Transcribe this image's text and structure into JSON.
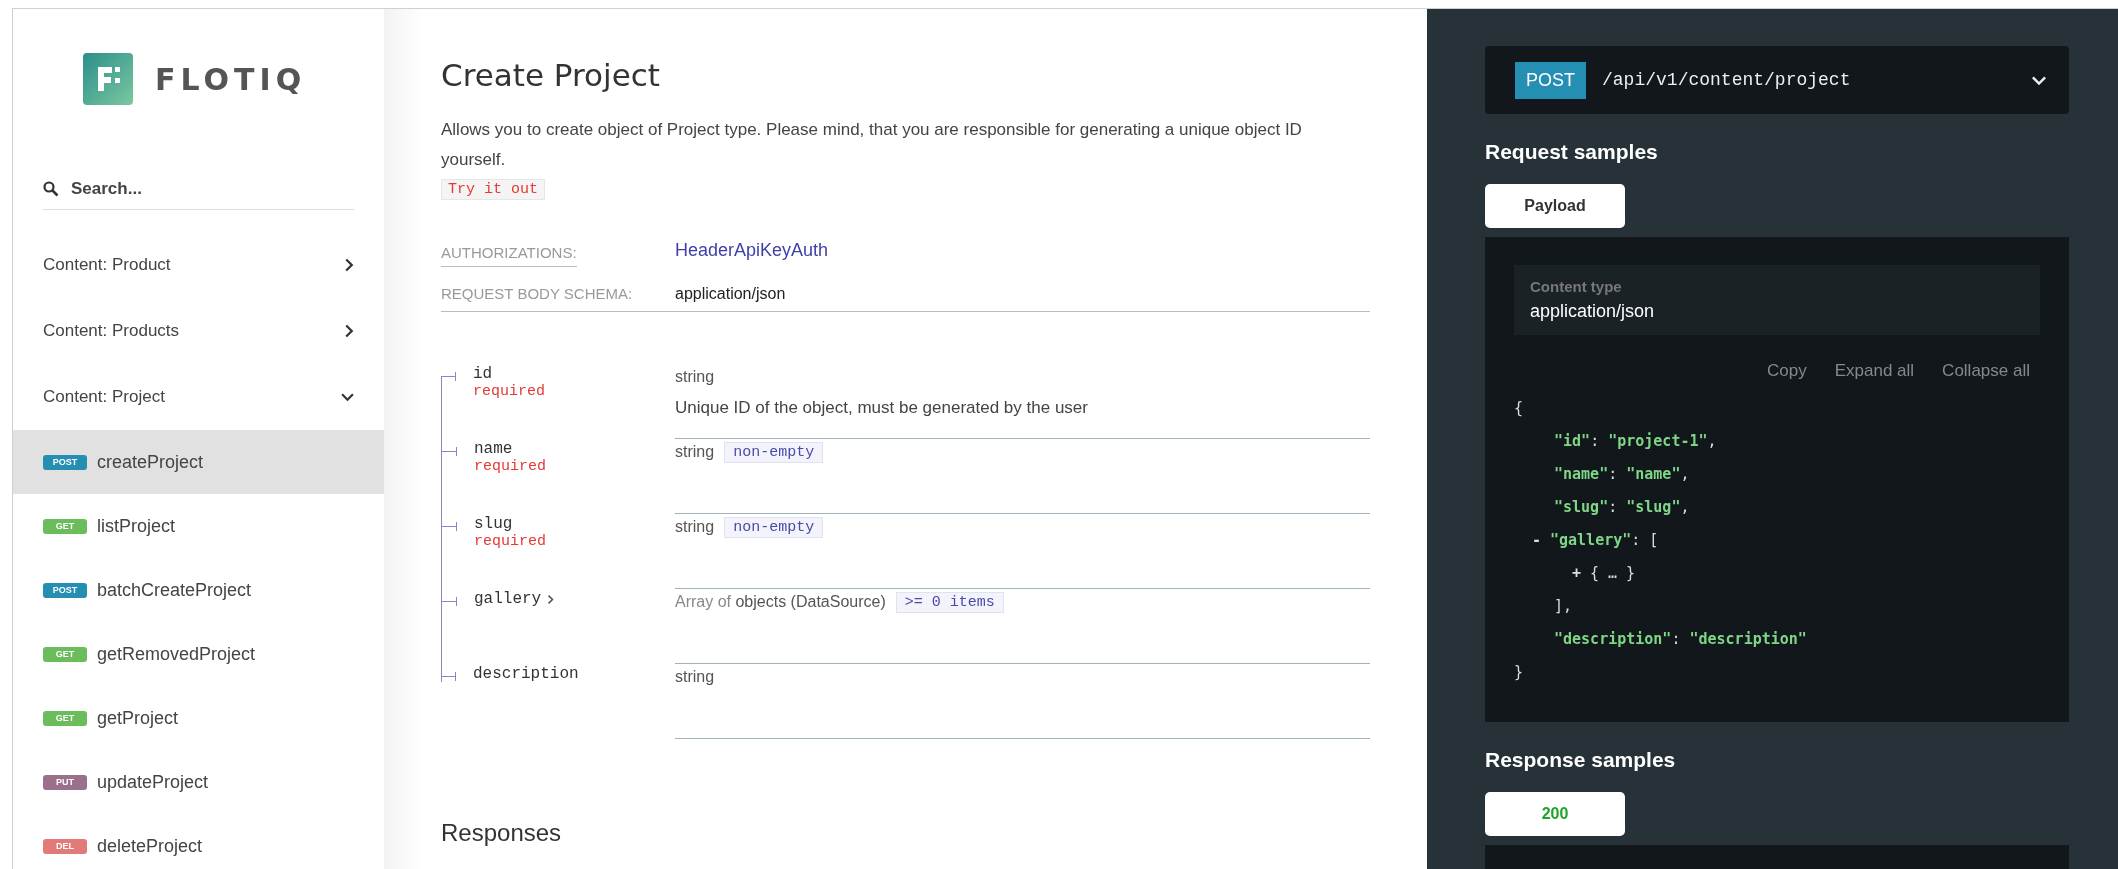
{
  "sidebar": {
    "logo": "FLOTIQ",
    "search": {
      "placeholder": "Search..."
    },
    "groups": [
      {
        "label": "Content: Product",
        "expanded": false
      },
      {
        "label": "Content: Products",
        "expanded": false
      },
      {
        "label": "Content: Project",
        "expanded": true,
        "children": [
          {
            "method": "POST",
            "color": "#248fb2",
            "label": "createProject",
            "selected": true
          },
          {
            "method": "GET",
            "color": "#6bbd5b",
            "label": "listProject",
            "selected": false
          },
          {
            "method": "POST",
            "color": "#248fb2",
            "label": "batchCreateProject",
            "selected": false
          },
          {
            "method": "GET",
            "color": "#6bbd5b",
            "label": "getRemovedProject",
            "selected": false
          },
          {
            "method": "GET",
            "color": "#6bbd5b",
            "label": "getProject",
            "selected": false
          },
          {
            "method": "PUT",
            "color": "#9b708b",
            "label": "updateProject",
            "selected": false
          },
          {
            "method": "DEL",
            "color": "#e27a7a",
            "label": "deleteProject",
            "selected": false
          }
        ]
      }
    ]
  },
  "operation": {
    "title": "Create Project",
    "description": "Allows you to create object of Project type. Please mind, that you are responsible for generating a unique object ID yourself.",
    "try_button": "Try it out",
    "authorizations": {
      "label": "AUTHORIZATIONS:",
      "value": "HeaderApiKeyAuth"
    },
    "request_body": {
      "label": "REQUEST BODY SCHEMA:",
      "value": "application/json"
    },
    "fields": [
      {
        "name": "id",
        "required": "required",
        "type": "string",
        "description": "Unique ID of the object, must be generated by the user",
        "expandable": false
      },
      {
        "name": "name",
        "required": "required",
        "type": "string",
        "constraint": "non-empty",
        "expandable": false
      },
      {
        "name": "slug",
        "required": "required",
        "type": "string",
        "constraint": "non-empty",
        "expandable": false
      },
      {
        "name": "gallery",
        "type_prefix": "Array of",
        "type": "objects (DataSource)",
        "constraint": ">= 0 items",
        "expandable": true
      },
      {
        "name": "description",
        "type": "string",
        "expandable": false
      }
    ],
    "responses_title": "Responses"
  },
  "samples": {
    "method": {
      "label": "POST",
      "color": "#248fb2"
    },
    "path": "/api/v1/content/project",
    "expanded": false,
    "request_title": "Request samples",
    "request_tabs": [
      {
        "label": "Payload",
        "selected": true
      }
    ],
    "content_type": {
      "label": "Content type",
      "value": "application/json"
    },
    "actions": [
      "Copy",
      "Expand all",
      "Collapse all"
    ],
    "code": {
      "open": "{",
      "close": "}",
      "items": [
        {
          "tokens": [
            {
              "kind": "string",
              "text": "\"id\""
            },
            {
              "kind": "punct",
              "text": ": "
            },
            {
              "kind": "string",
              "text": "\"project-1\""
            },
            {
              "kind": "punct",
              "text": ","
            }
          ]
        },
        {
          "tokens": [
            {
              "kind": "string",
              "text": "\"name\""
            },
            {
              "kind": "punct",
              "text": ": "
            },
            {
              "kind": "string",
              "text": "\"name\""
            },
            {
              "kind": "punct",
              "text": ","
            }
          ]
        },
        {
          "tokens": [
            {
              "kind": "string",
              "text": "\"slug\""
            },
            {
              "kind": "punct",
              "text": ": "
            },
            {
              "kind": "string",
              "text": "\"slug\""
            },
            {
              "kind": "punct",
              "text": ","
            }
          ]
        },
        {
          "toggle": "-",
          "tokens": [
            {
              "kind": "string",
              "text": "\"gallery\""
            },
            {
              "kind": "punct",
              "text": ": ["
            }
          ],
          "children": [
            {
              "toggle": "+",
              "tokens": [
                {
                  "kind": "punct",
                  "text": "{ … }"
                }
              ]
            }
          ],
          "close": "],"
        },
        {
          "tokens": [
            {
              "kind": "string",
              "text": "\"description\""
            },
            {
              "kind": "punct",
              "text": ": "
            },
            {
              "kind": "string",
              "text": "\"description\""
            }
          ]
        }
      ]
    },
    "response_title": "Response samples",
    "response_tabs": [
      {
        "label": "200",
        "selected": true,
        "color": "#1fa32a"
      }
    ]
  }
}
